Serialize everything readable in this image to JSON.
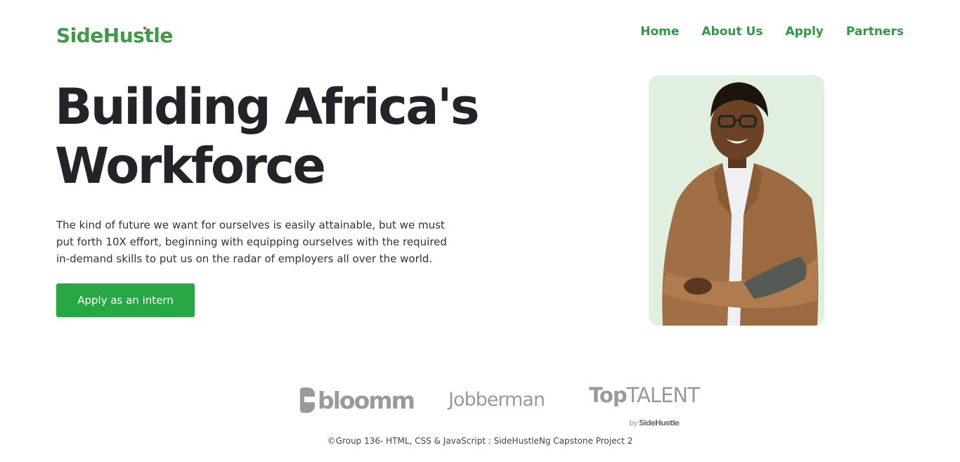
{
  "brand": {
    "logo_text": "SideHustle",
    "primary_color": "#28a745",
    "dark_text": "#212529"
  },
  "nav": {
    "items": [
      {
        "label": "Home"
      },
      {
        "label": "About Us"
      },
      {
        "label": "Apply"
      },
      {
        "label": "Partners"
      }
    ]
  },
  "hero": {
    "title": "Building Africa's Workforce",
    "description": "The kind of future we want for ourselves is easily attainable, but we must put forth 10X effort, beginning with equipping ourselves with the required in-demand skills to put us on the radar of employers all over the world.",
    "cta_label": "Apply as an intern"
  },
  "partners": {
    "bloomm": "bloomm",
    "jobberman": "Jobberman",
    "toptalent_bold": "Top",
    "toptalent_thin": "TALENT",
    "toptalent_by": "by",
    "toptalent_brand": "SideHustle"
  },
  "footer": {
    "text": "©Group 136- HTML, CSS & JavaScript : SideHustleNg Capstone Project 2"
  }
}
